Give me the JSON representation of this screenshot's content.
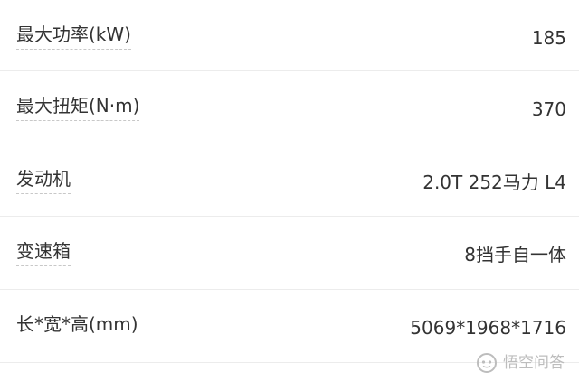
{
  "specs": [
    {
      "label": "最大功率(kW)",
      "value": "185"
    },
    {
      "label": "最大扭矩(N·m)",
      "value": "370"
    },
    {
      "label": "发动机",
      "value": "2.0T 252马力 L4"
    },
    {
      "label": "变速箱",
      "value": "8挡手自一体"
    },
    {
      "label": "长*宽*高(mm)",
      "value": "5069*1968*1716"
    }
  ],
  "watermark": {
    "text": "悟空问答",
    "icon": "wukong-logo-icon",
    "color": "#bdbdbd"
  },
  "colors": {
    "text": "#333333",
    "divider": "#ececec",
    "underline": "#c8c8c8"
  }
}
